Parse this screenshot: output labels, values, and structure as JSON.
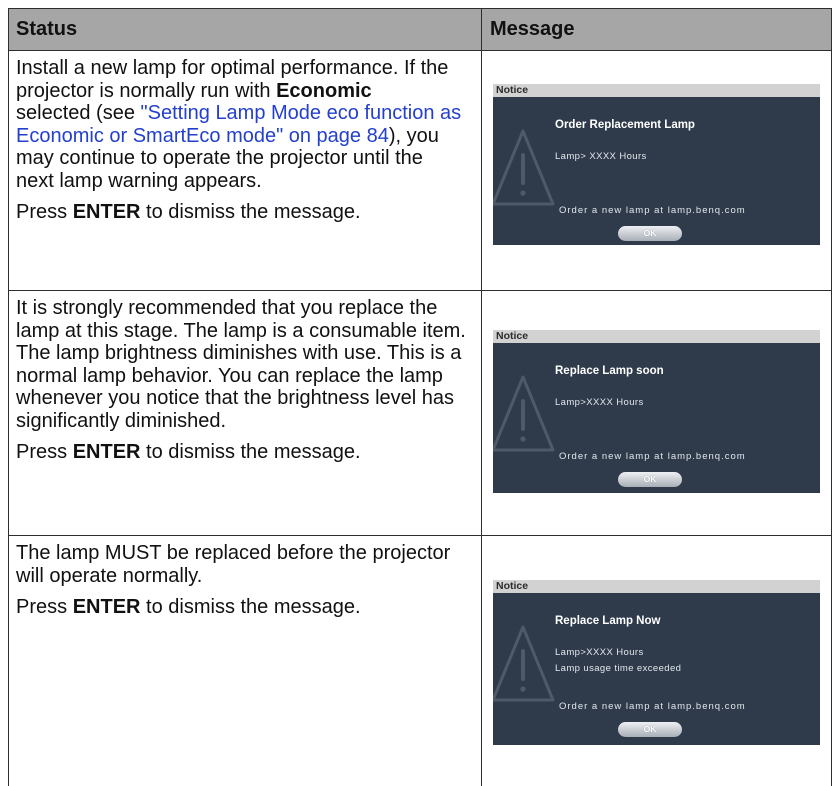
{
  "colors": {
    "header_bg": "#a6a6a6",
    "border": "#2e2e2e",
    "text": "#111111",
    "link": "#2340cc",
    "notice_body": "#2f3b4a",
    "notice_header": "#d2d2d2"
  },
  "table": {
    "columns": {
      "status": "Status",
      "message": "Message"
    },
    "rows": [
      {
        "status": {
          "p1": [
            [
              "Install a new lamp for optimal performance. If the"
            ],
            [
              "projector is normally run with ",
              "Economic"
            ],
            [
              "selected (see ",
              "\"Setting Lamp Mode eco function as"
            ],
            [
              "Economic or SmartEco mode\" on page 84",
              "), you"
            ],
            [
              "may continue to operate the projector until the"
            ],
            [
              "next lamp warning appears."
            ]
          ],
          "p2": [
            "Press ",
            "ENTER",
            " to dismiss the message."
          ]
        },
        "notice": {
          "header": "Notice",
          "icon": "warning-triangle-icon",
          "title": "Order Replacement Lamp",
          "details": [
            "Lamp> XXXX Hours"
          ],
          "order": "Order a new lamp at lamp.benq.com",
          "ok": "OK"
        }
      },
      {
        "status": {
          "p1": [
            [
              "It is strongly recommended that you replace the"
            ],
            [
              "lamp at this stage. The lamp is a consumable item."
            ],
            [
              "The lamp brightness diminishes with use. This is a"
            ],
            [
              "normal lamp behavior. You can replace the lamp"
            ],
            [
              "whenever you notice that the brightness level has"
            ],
            [
              "significantly diminished."
            ]
          ],
          "p2": [
            "Press ",
            "ENTER",
            " to dismiss the message."
          ]
        },
        "notice": {
          "header": "Notice",
          "icon": "warning-triangle-icon",
          "title": "Replace Lamp soon",
          "details": [
            "Lamp>XXXX Hours"
          ],
          "order": "Order a new lamp at lamp.benq.com",
          "ok": "OK"
        }
      },
      {
        "status": {
          "p1": [
            [
              "The lamp MUST be replaced before the projector"
            ],
            [
              "will operate normally."
            ]
          ],
          "p2": [
            "Press ",
            "ENTER",
            " to dismiss the message."
          ]
        },
        "notice": {
          "header": "Notice",
          "icon": "warning-triangle-icon",
          "title": "Replace Lamp Now",
          "details": [
            "Lamp>XXXX Hours",
            "Lamp usage time exceeded"
          ],
          "order": "Order a new lamp at lamp.benq.com",
          "ok": "OK"
        }
      }
    ]
  }
}
